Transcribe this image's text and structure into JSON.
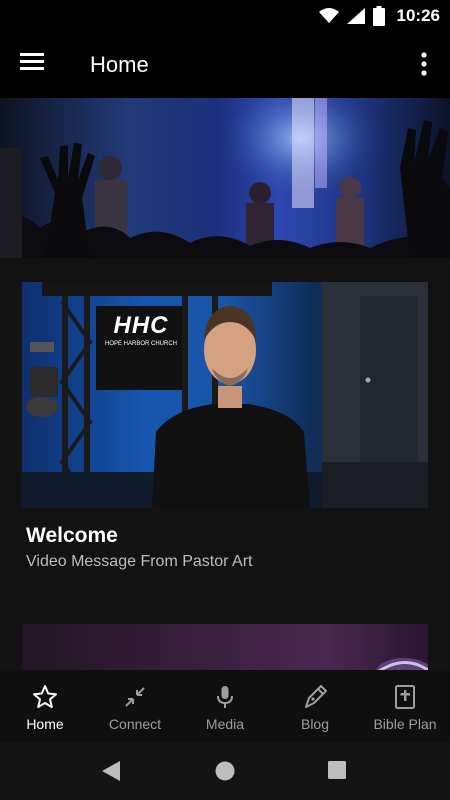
{
  "status_bar": {
    "time": "10:26"
  },
  "app_bar": {
    "title": "Home"
  },
  "hero": {},
  "card": {
    "logo_text": "HHC",
    "logo_subtext": "HOPE HARBOR CHURCH",
    "title": "Welcome",
    "subtitle": "Video Message From Pastor Art"
  },
  "bottom_nav": {
    "items": [
      {
        "label": "Home",
        "icon": "star-icon",
        "active": true
      },
      {
        "label": "Connect",
        "icon": "collapse-arrows-icon",
        "active": false
      },
      {
        "label": "Media",
        "icon": "microphone-icon",
        "active": false
      },
      {
        "label": "Blog",
        "icon": "pen-icon",
        "active": false
      },
      {
        "label": "Bible Plan",
        "icon": "bible-icon",
        "active": false
      }
    ]
  },
  "colors": {
    "background": "#121212",
    "bar": "#000000",
    "active_label": "#ffffff",
    "inactive_label": "#9e9e9e"
  }
}
